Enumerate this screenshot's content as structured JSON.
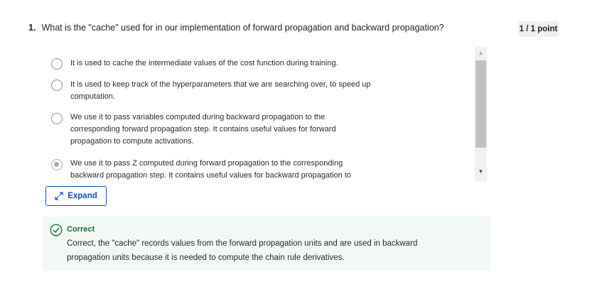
{
  "question": {
    "number": "1.",
    "text": "What is the \"cache\" used for in our implementation of forward propagation and backward propagation?"
  },
  "points": "1 / 1 point",
  "options": [
    {
      "lines": [
        "It is used to cache the intermediate values of the cost function during training."
      ],
      "selected": false
    },
    {
      "lines": [
        "It is used to keep track of the hyperparameters that we are searching over, to speed up",
        "computation."
      ],
      "selected": false
    },
    {
      "lines": [
        "We use it to pass variables computed during backward propagation to the",
        "corresponding forward propagation step. It contains useful values for forward",
        "propagation to compute activations."
      ],
      "selected": false
    },
    {
      "lines": [
        "We use it to pass Z computed during forward propagation to the corresponding",
        "backward propagation step. It contains useful values for backward propagation to"
      ],
      "selected": true
    }
  ],
  "expand_label": "Expand",
  "feedback": {
    "status": "Correct",
    "lines": [
      "Correct, the \"cache\" records values from the forward propagation units and are used in backward",
      "propagation units because it is needed to compute the chain rule derivatives."
    ]
  },
  "icons": {
    "scroll_up": "scroll-up-arrow-icon",
    "scroll_down": "scroll-down-arrow-icon",
    "expand": "expand-arrows-icon",
    "correct": "check-circle-icon"
  },
  "colors": {
    "accent": "#0056d2",
    "success": "#1e6a3a",
    "feedback_bg": "#f2f8f4",
    "badge_bg": "#eef0f2"
  }
}
